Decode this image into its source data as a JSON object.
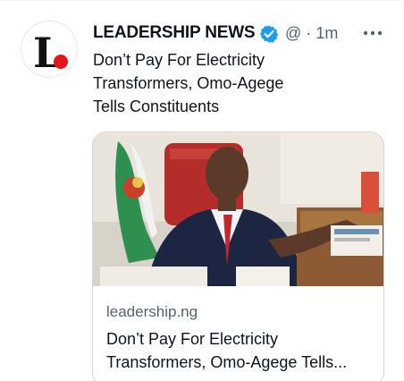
{
  "tweet": {
    "author": {
      "display_name": "LEADERSHIP NEWS",
      "handle": "@",
      "separator": "·",
      "time": "1m",
      "avatar_letter": "L",
      "verified_icon": "verified-badge-icon",
      "verified_color": "#1d9bf0"
    },
    "text_lines": [
      "Don’t Pay For Electricity",
      "Transformers, Omo-Agege",
      "Tells Constituents"
    ],
    "more_icon": "more-options-icon",
    "card": {
      "image_icon": "news-photo-image",
      "domain": "leadership.ng",
      "title_lines": [
        "Don’t Pay For Electricity",
        "Transformers, Omo-Agege Tells..."
      ]
    }
  },
  "colors": {
    "text_primary": "#0f1419",
    "text_secondary": "#536471",
    "border": "#cfd9de",
    "brand_red": "#e3171b"
  }
}
